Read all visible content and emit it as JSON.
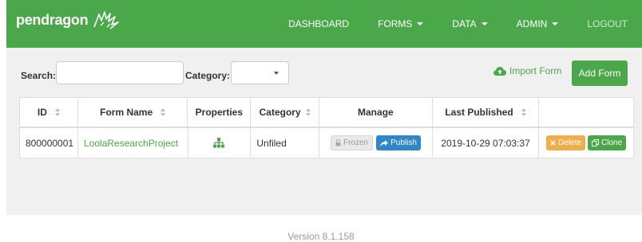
{
  "brand": {
    "name": "pendragon"
  },
  "nav": {
    "dashboard": "DASHBOARD",
    "forms": "FORMS",
    "data": "DATA",
    "admin": "ADMIN",
    "logout": "LOGOUT"
  },
  "filters": {
    "search_label": "Search:",
    "search_value": "",
    "category_label": "Category:",
    "category_value": ""
  },
  "actions": {
    "import_label": "Import Form",
    "add_label": "Add Form"
  },
  "table": {
    "headers": {
      "id": "ID",
      "form_name": "Form Name",
      "properties": "Properties",
      "category": "Category",
      "manage": "Manage",
      "last_published": "Last Published"
    },
    "rows": [
      {
        "id": "800000001",
        "form_name": "LoolaResearchProject",
        "category": "Unfiled",
        "frozen_label": "Frozen",
        "publish_label": "Publish",
        "last_published": "2019-10-29 07:03:37",
        "delete_label": "Delete",
        "clone_label": "Clone"
      }
    ]
  },
  "footer": {
    "version": "Version 8.1.158"
  },
  "colors": {
    "brand_green": "#4aa84a",
    "publish_blue": "#2f86c8",
    "delete_orange": "#f0ad4e"
  }
}
